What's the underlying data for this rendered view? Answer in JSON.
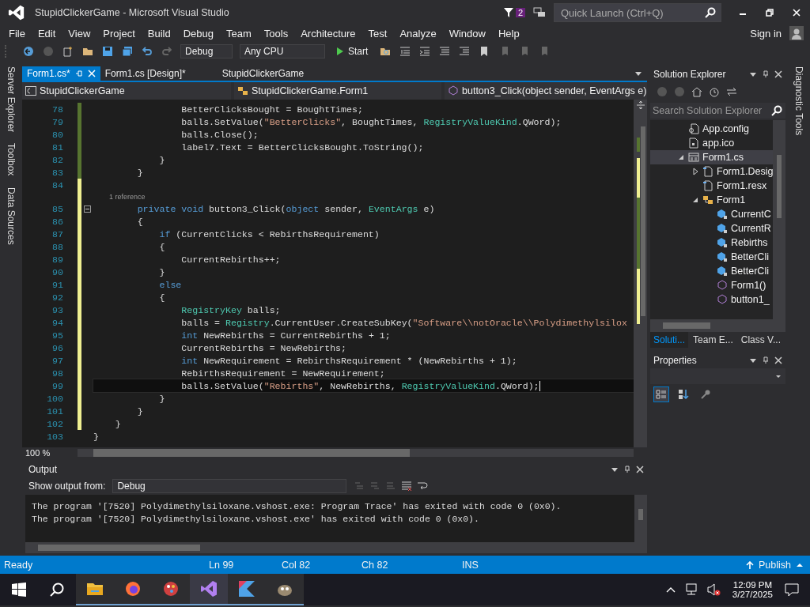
{
  "window": {
    "title": "StupidClickerGame - Microsoft Visual Studio",
    "notification_count": "2"
  },
  "quick_launch": {
    "placeholder": "Quick Launch (Ctrl+Q)"
  },
  "menu": [
    "File",
    "Edit",
    "View",
    "Project",
    "Build",
    "Debug",
    "Team",
    "Tools",
    "Architecture",
    "Test",
    "Analyze",
    "Window",
    "Help"
  ],
  "account": {
    "label": "Sign in"
  },
  "toolbar": {
    "configuration": "Debug",
    "platform": "Any CPU",
    "start": "Start"
  },
  "left_tabs": [
    "Server Explorer",
    "Toolbox",
    "Data Sources"
  ],
  "right_tabs": [
    "Diagnostic Tools"
  ],
  "editor": {
    "tabs": [
      {
        "label": "Form1.cs*",
        "selected": true
      },
      {
        "label": "Form1.cs [Design]*",
        "selected": false
      }
    ],
    "project_label": "StupidClickerGame",
    "nav": {
      "project": "StupidClickerGame",
      "type": "StupidClickerGame.Form1",
      "member": "button3_Click(object sender, EventArgs e)"
    },
    "lines": [
      {
        "number": "78",
        "saved": true,
        "tokens": [
          {
            "kind": "p",
            "text": "                BetterClicksBought = BoughtTimes;"
          }
        ]
      },
      {
        "number": "79",
        "saved": true,
        "tokens": [
          {
            "kind": "p",
            "text": "                balls.SetValue("
          },
          {
            "kind": "s",
            "text": "\"BetterClicks\""
          },
          {
            "kind": "p",
            "text": ", BoughtTimes, "
          },
          {
            "kind": "t",
            "text": "RegistryValueKind"
          },
          {
            "kind": "p",
            "text": ".QWord);"
          }
        ]
      },
      {
        "number": "80",
        "saved": true,
        "tokens": [
          {
            "kind": "p",
            "text": "                balls.Close();"
          }
        ]
      },
      {
        "number": "81",
        "saved": true,
        "tokens": [
          {
            "kind": "p",
            "text": "                label7.Text = BetterClicksBought.ToString();"
          }
        ]
      },
      {
        "number": "82",
        "saved": true,
        "tokens": [
          {
            "kind": "p",
            "text": "            }"
          }
        ]
      },
      {
        "number": "83",
        "saved": true,
        "tokens": [
          {
            "kind": "p",
            "text": "        }"
          }
        ]
      },
      {
        "number": "84",
        "saved": false
      },
      {
        "number": "85",
        "saved": false,
        "codelens": "1 reference",
        "expanded": true,
        "tokens": [
          {
            "kind": "k",
            "text": "        private void"
          },
          {
            "kind": "p",
            "text": " button3_Click("
          },
          {
            "kind": "k",
            "text": "object"
          },
          {
            "kind": "p",
            "text": " sender, "
          },
          {
            "kind": "t",
            "text": "EventArgs"
          },
          {
            "kind": "p",
            "text": " e)"
          }
        ]
      },
      {
        "number": "86",
        "saved": false,
        "tokens": [
          {
            "kind": "p",
            "text": "        {"
          }
        ]
      },
      {
        "number": "87",
        "saved": false,
        "tokens": [
          {
            "kind": "k",
            "text": "            if"
          },
          {
            "kind": "p",
            "text": " (CurrentClicks < RebirthsRequirement)"
          }
        ]
      },
      {
        "number": "88",
        "saved": false,
        "tokens": [
          {
            "kind": "p",
            "text": "            {"
          }
        ]
      },
      {
        "number": "89",
        "saved": false,
        "tokens": [
          {
            "kind": "p",
            "text": "                CurrentRebirths++;"
          }
        ]
      },
      {
        "number": "90",
        "saved": false,
        "tokens": [
          {
            "kind": "p",
            "text": "            }"
          }
        ]
      },
      {
        "number": "91",
        "saved": false,
        "tokens": [
          {
            "kind": "k",
            "text": "            else"
          }
        ]
      },
      {
        "number": "92",
        "saved": false,
        "tokens": [
          {
            "kind": "p",
            "text": "            {"
          }
        ]
      },
      {
        "number": "93",
        "saved": false,
        "tokens": [
          {
            "kind": "t",
            "text": "                RegistryKey"
          },
          {
            "kind": "p",
            "text": " balls;"
          }
        ]
      },
      {
        "number": "94",
        "saved": false,
        "tokens": [
          {
            "kind": "p",
            "text": "                balls = "
          },
          {
            "kind": "t",
            "text": "Registry"
          },
          {
            "kind": "p",
            "text": ".CurrentUser.CreateSubKey("
          },
          {
            "kind": "s",
            "text": "\"Software\\\\notOracle\\\\Polydimethylsilox"
          }
        ]
      },
      {
        "number": "95",
        "saved": false,
        "tokens": [
          {
            "kind": "k",
            "text": "                int"
          },
          {
            "kind": "p",
            "text": " NewRebirths = CurrentRebirths + 1;"
          }
        ]
      },
      {
        "number": "96",
        "saved": false,
        "tokens": [
          {
            "kind": "p",
            "text": "                CurrentRebirths = NewRebirths;"
          }
        ]
      },
      {
        "number": "97",
        "saved": false,
        "tokens": [
          {
            "kind": "k",
            "text": "                int"
          },
          {
            "kind": "p",
            "text": " NewRequirement = RebirthsRequirement * (NewRebirths + 1);"
          }
        ]
      },
      {
        "number": "98",
        "saved": false,
        "tokens": [
          {
            "kind": "p",
            "text": "                RebirthsRequirement = NewRequirement;"
          }
        ]
      },
      {
        "number": "99",
        "saved": false,
        "current": true,
        "tokens": [
          {
            "kind": "p",
            "text": "                balls.SetValue("
          },
          {
            "kind": "s",
            "text": "\"Rebirths\""
          },
          {
            "kind": "p",
            "text": ", NewRebirths, "
          },
          {
            "kind": "t",
            "text": "RegistryValueKind"
          },
          {
            "kind": "p",
            "text": ".QWord);"
          }
        ]
      },
      {
        "number": "100",
        "saved": false,
        "tokens": [
          {
            "kind": "p",
            "text": "            }"
          }
        ]
      },
      {
        "number": "101",
        "saved": false,
        "tokens": [
          {
            "kind": "p",
            "text": "        }"
          }
        ]
      },
      {
        "number": "102",
        "saved": false,
        "tokens": [
          {
            "kind": "p",
            "text": "    }"
          }
        ]
      },
      {
        "number": "103",
        "tokens": [
          {
            "kind": "p",
            "text": "}"
          }
        ]
      }
    ],
    "zoom": "100 %"
  },
  "output": {
    "title": "Output",
    "source_label": "Show output from:",
    "source": "Debug",
    "lines": [
      "The program '[7520] Polydimethylsiloxane.vshost.exe: Program Trace' has exited with code 0 (0x0).",
      "The program '[7520] Polydimethylsiloxane.vshost.exe' has exited with code 0 (0x0)."
    ]
  },
  "solution_explorer": {
    "title": "Solution Explorer",
    "search": {
      "placeholder": "Search Solution Explorer"
    },
    "tree": [
      {
        "label": "App.config",
        "kind": "config",
        "selected": false
      },
      {
        "label": "app.ico",
        "kind": "icon-file",
        "selected": false
      },
      {
        "label": "Form1.cs",
        "kind": "form",
        "selected": true,
        "expanded": true,
        "children": [
          {
            "label": "Form1.Desig",
            "kind": "code-file",
            "selected": false,
            "expanded": false
          },
          {
            "label": "Form1.resx",
            "kind": "code-file",
            "selected": false
          },
          {
            "label": "Form1",
            "kind": "class",
            "selected": false,
            "expanded": true,
            "children": [
              {
                "label": "CurrentC",
                "kind": "field",
                "selected": false
              },
              {
                "label": "CurrentR",
                "kind": "field",
                "selected": false
              },
              {
                "label": "Rebirths",
                "kind": "field",
                "selected": false
              },
              {
                "label": "BetterCli",
                "kind": "field",
                "selected": false
              },
              {
                "label": "BetterCli",
                "kind": "field",
                "selected": false
              },
              {
                "label": "Form1()",
                "kind": "method",
                "selected": false
              },
              {
                "label": "button1_",
                "kind": "method",
                "selected": false
              }
            ]
          }
        ]
      }
    ],
    "tabs": [
      {
        "label": "Soluti...",
        "selected": true
      },
      {
        "label": "Team E...",
        "selected": false
      },
      {
        "label": "Class V...",
        "selected": false
      }
    ]
  },
  "properties": {
    "title": "Properties",
    "buttons": [
      {
        "kind": "categorized",
        "selected": true
      },
      {
        "kind": "alphabetical",
        "selected": false
      },
      {
        "kind": "property-pages",
        "selected": false
      }
    ]
  },
  "status_bar": {
    "state": "Ready",
    "line": "Ln 99",
    "column": "Col 82",
    "char": "Ch 82",
    "mode": "INS",
    "publish": "Publish"
  },
  "taskbar": {
    "apps": [
      {
        "kind": "file-explorer",
        "selected": false
      },
      {
        "kind": "firefox",
        "selected": false
      },
      {
        "kind": "paint",
        "selected": false
      },
      {
        "kind": "visual-studio",
        "selected": true
      },
      {
        "kind": "kotlin",
        "selected": false
      },
      {
        "kind": "gimp",
        "selected": false
      }
    ],
    "time": "12:09 PM",
    "date": "3/27/2025"
  }
}
